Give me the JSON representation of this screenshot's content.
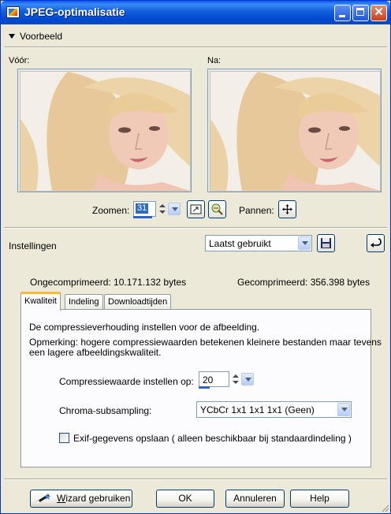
{
  "window": {
    "title": "JPEG-optimalisatie"
  },
  "preview_section": {
    "header": "Voorbeeld",
    "before_label": "Vóór:",
    "after_label": "Na:",
    "zoom_label": "Zoomen:",
    "zoom_value": "31",
    "pan_label": "Pannen:"
  },
  "settings": {
    "label": "Instellingen",
    "preset_value": "Laatst gebruikt"
  },
  "sizes": {
    "uncompressed": "Ongecomprimeerd: 10.171.132 bytes",
    "compressed": "Gecomprimeerd: 356.398 bytes"
  },
  "tabs": [
    {
      "label": "Kwaliteit",
      "active": true
    },
    {
      "label": "Indeling",
      "active": false
    },
    {
      "label": "Downloadtijden",
      "active": false
    }
  ],
  "quality": {
    "description": "De compressieverhouding instellen voor de afbeelding.",
    "note_line1": "Opmerking:  hogere compressiewaarden betekenen kleinere bestanden maar tevens",
    "note_line2": "een lagere afbeeldingskwaliteit.",
    "compression_label": "Compressiewaarde instellen op:",
    "compression_value": "20",
    "chroma_label": "Chroma-subsampling:",
    "chroma_value": "YCbCr 1x1 1x1 1x1 (Geen)",
    "exif_label": "Exif-gegevens opslaan ( alleen beschikbaar bij standaardindeling )",
    "exif_checked": false
  },
  "buttons": {
    "wizard_prefix": "",
    "wizard_underlined": "W",
    "wizard_rest": "izard gebruiken",
    "ok": "OK",
    "cancel": "Annuleren",
    "help": "Help"
  },
  "colors": {
    "titlebar": "#0a5ae9",
    "dialog_bg": "#ece9d8",
    "accent_bar": "#3163c5",
    "tab_highlight": "#f9b934"
  },
  "icons": [
    "app-icon",
    "minimize-icon",
    "maximize-icon",
    "close-icon",
    "collapse-triangle-icon",
    "fit-window-icon",
    "reset-zoom-icon",
    "pan-cross-icon",
    "save-preset-icon",
    "reset-preset-icon",
    "wizard-icon",
    "dropdown-arrow-icon",
    "spin-arrows-icon"
  ]
}
